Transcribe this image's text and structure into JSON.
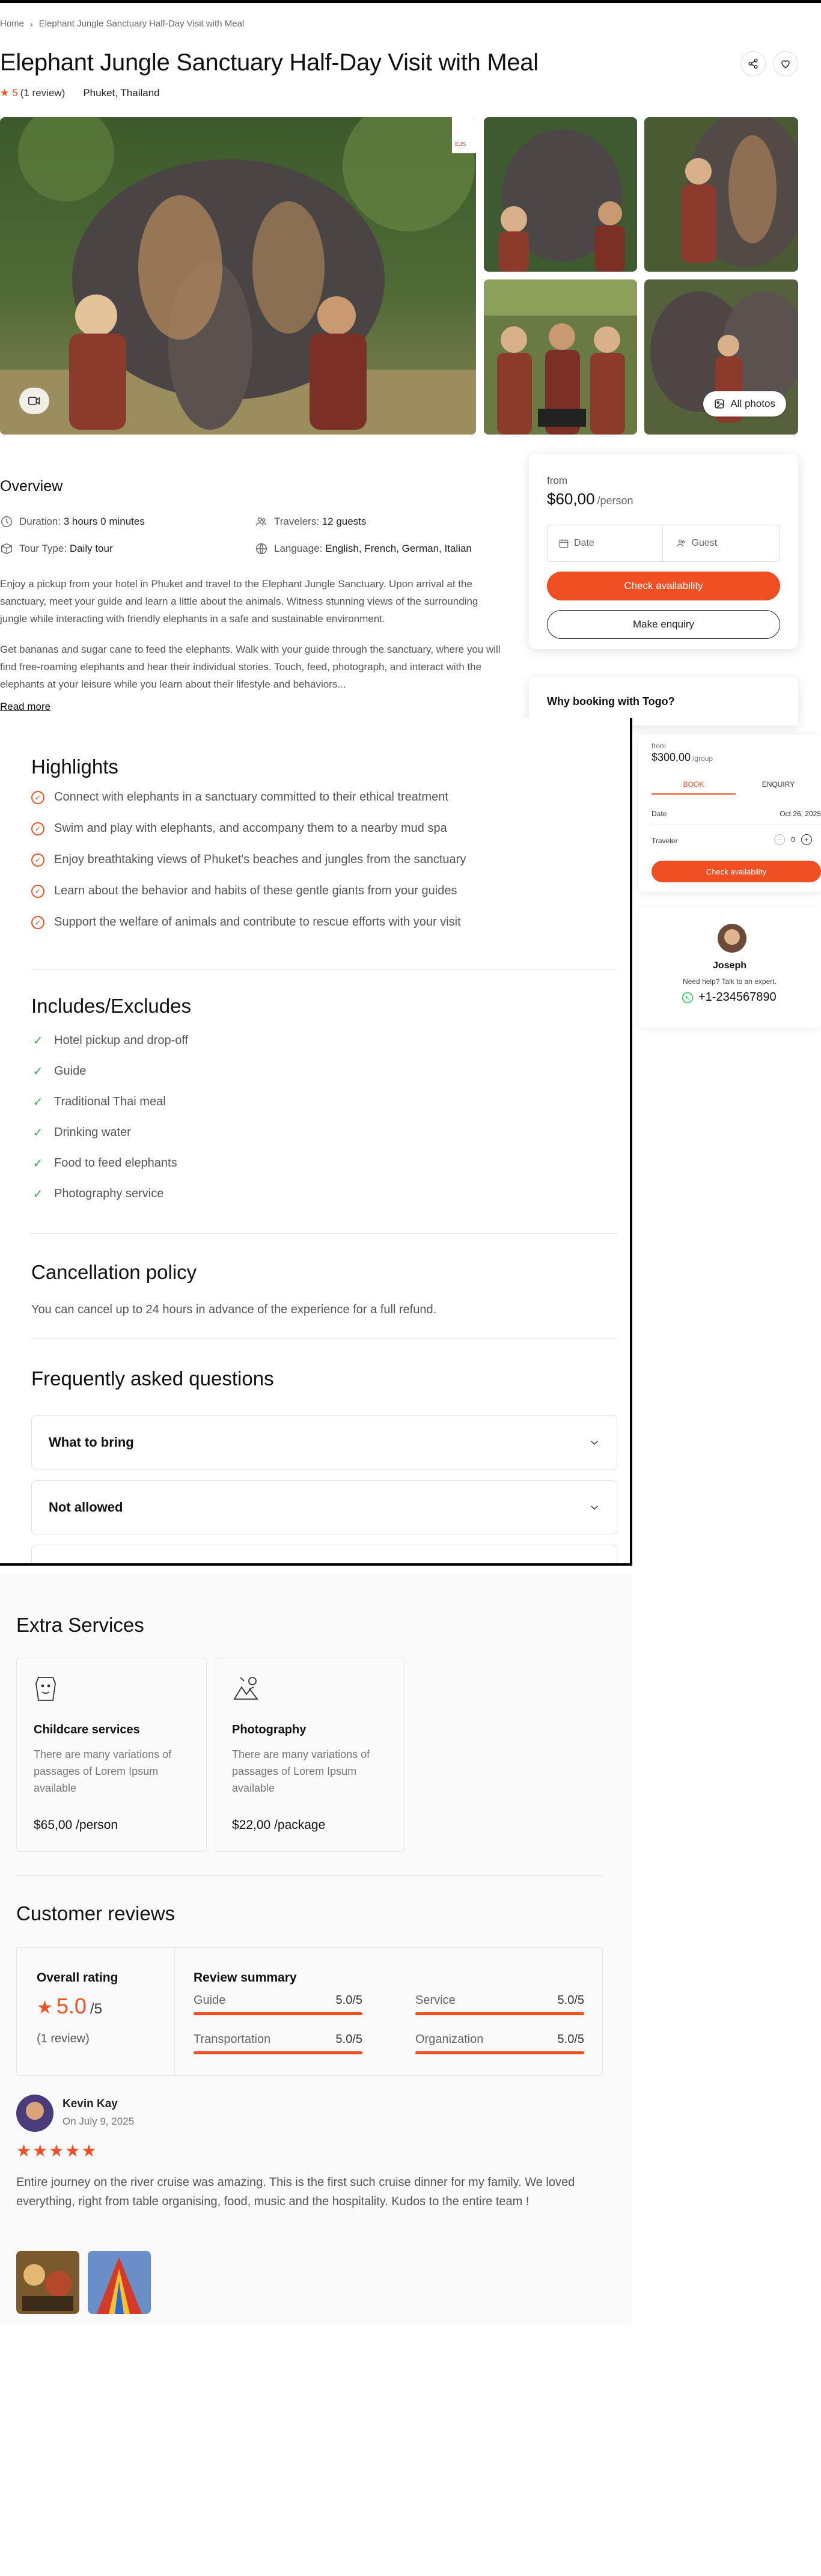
{
  "breadcrumb": {
    "home": "Home",
    "current": "Elephant Jungle Sanctuary Half-Day Visit with Meal"
  },
  "tour": {
    "title": "Elephant Jungle Sanctuary Half-Day Visit with Meal",
    "rating": "5",
    "reviews": "(1 review)",
    "location": "Phuket, Thailand"
  },
  "gallery": {
    "all_photos_label": "All photos"
  },
  "overview": {
    "heading": "Overview",
    "duration_label": "Duration:",
    "duration_value": "3 hours 0 minutes",
    "travelers_label": "Travelers:",
    "travelers_value": "12 guests",
    "tourtype_label": "Tour Type:",
    "tourtype_value": "Daily tour",
    "language_label": "Language:",
    "language_value": "English, French, German, Italian",
    "p1": "Enjoy a pickup from your hotel in Phuket and travel to the Elephant Jungle Sanctuary. Upon arrival at the sanctuary, meet your guide and learn a little about the animals. Witness stunning views of the surrounding jungle while interacting with friendly elephants in a safe and sustainable environment.",
    "p2": "Get bananas and sugar cane to feed the elephants. Walk with your guide through the sanctuary, where you will find free-roaming elephants and hear their individual stories. Touch, feed, photograph, and interact with the elephants at your leisure while you learn about their lifestyle and behaviors...",
    "read_more": "Read more"
  },
  "booking": {
    "from": "from",
    "price": "$60,00",
    "per": "/person",
    "date_placeholder": "Date",
    "guest_placeholder": "Guest",
    "check_btn": "Check availability",
    "enquiry_btn": "Make enquiry",
    "why": "Why booking with Togo?"
  },
  "highlights": {
    "heading": "Highlights",
    "items": [
      "Connect with elephants in a sanctuary committed to their ethical treatment",
      "Swim and play with elephants, and accompany them to a nearby mud spa",
      "Enjoy breathtaking views of Phuket's beaches and jungles from the sanctuary",
      "Learn about the behavior and habits of these gentle giants from your guides",
      "Support the welfare of animals and contribute to rescue efforts with your visit"
    ]
  },
  "includes": {
    "heading": "Includes/Excludes",
    "items": [
      "Hotel pickup and drop-off",
      "Guide",
      "Traditional Thai meal",
      "Drinking water",
      "Food to feed elephants",
      "Photography service"
    ]
  },
  "cancellation": {
    "heading": "Cancellation policy",
    "text": "You can cancel up to 24 hours in advance of the experience for a full refund."
  },
  "faq": {
    "heading": "Frequently asked questions",
    "items": [
      "What to bring",
      "Not allowed"
    ]
  },
  "mini_booking": {
    "from": "from",
    "price": "$300,00",
    "per": "/group",
    "tab_book": "BOOK",
    "tab_enquiry": "ENQUIRY",
    "date_label": "Date",
    "date_value": "Oct 26, 2025",
    "traveler_label": "Traveler",
    "traveler_count": "0",
    "check_btn": "Check availability"
  },
  "agent": {
    "name": "Joseph",
    "help": "Need help? Talk to an expert.",
    "phone": "+1-234567890"
  },
  "extras": {
    "heading": "Extra Services",
    "services": [
      {
        "name": "Childcare services",
        "desc": "There are many variations of passages of Lorem Ipsum available",
        "price": "$65,00 /person"
      },
      {
        "name": "Photography",
        "desc": "There are many variations of passages of Lorem Ipsum available",
        "price": "$22,00 /package"
      }
    ]
  },
  "reviews": {
    "heading": "Customer reviews",
    "overall_label": "Overall rating",
    "overall_score": "5.0",
    "overall_max": "/5",
    "count": "(1 review)",
    "summary_label": "Review summary",
    "categories": [
      {
        "name": "Guide",
        "score": "5.0/5"
      },
      {
        "name": "Service",
        "score": "5.0/5"
      },
      {
        "name": "Transportation",
        "score": "5.0/5"
      },
      {
        "name": "Organization",
        "score": "5.0/5"
      }
    ],
    "review": {
      "author": "Kevin Kay",
      "date": "On July 9, 2025",
      "stars": "★★★★★",
      "text": "Entire journey on the river cruise was amazing. This is the first such cruise dinner for my family. We loved everything, right from table organising, food, music and the hospitality. Kudos to the entire team !"
    }
  },
  "colors": {
    "accent": "#f04e23",
    "check": "#2fb14a",
    "whatsapp": "#25d366"
  }
}
